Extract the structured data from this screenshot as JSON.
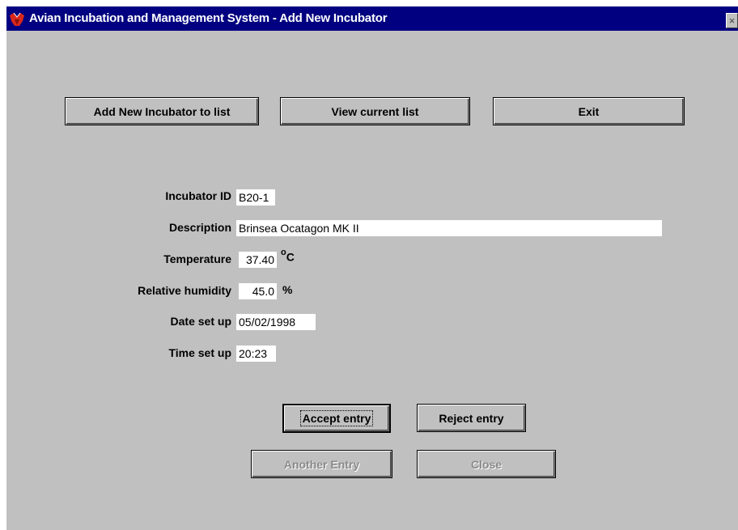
{
  "window": {
    "title": "Avian Incubation and Management System - Add New Incubator",
    "close_glyph": "×",
    "app_icon": "bird-icon"
  },
  "toolbar": {
    "add_label": "Add New Incubator to list",
    "view_label": "View current list",
    "exit_label": "Exit"
  },
  "form": {
    "incubator_id": {
      "label": "Incubator ID",
      "value": "B20-1"
    },
    "description": {
      "label": "Description",
      "value": "Brinsea Ocatagon MK II"
    },
    "temperature": {
      "label": "Temperature",
      "value": "37.40",
      "unit_symbol": "o",
      "unit_letter": "C"
    },
    "humidity": {
      "label": "Relative humidity",
      "value": "45.0",
      "unit": "%"
    },
    "date_set_up": {
      "label": "Date set up",
      "value": "05/02/1998"
    },
    "time_set_up": {
      "label": "Time set up",
      "value": "20:23"
    }
  },
  "actions": {
    "accept_label": "Accept entry",
    "reject_label": "Reject entry",
    "another_label": "Another Entry",
    "close_label": "Close"
  },
  "colors": {
    "titlebar": "#000080",
    "face": "#c0c0c0",
    "field": "#ffffff",
    "disabled_text": "#8a8a8a"
  }
}
